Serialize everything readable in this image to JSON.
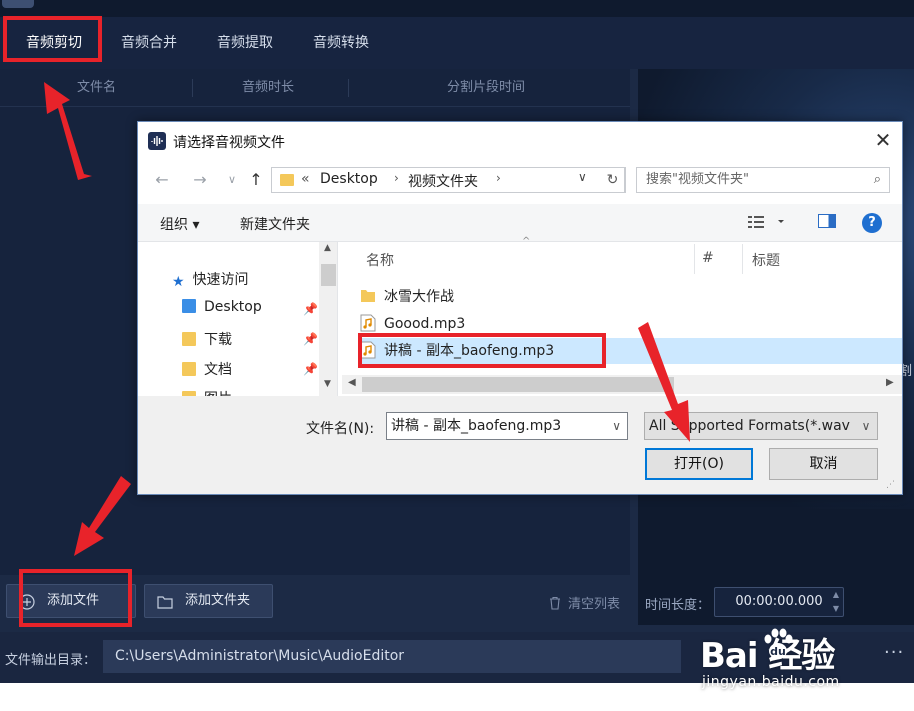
{
  "tabs": [
    "音频剪切",
    "音频合并",
    "音频提取",
    "音频转换"
  ],
  "columns": [
    "文件名",
    "音频时长",
    "分割片段时间"
  ],
  "bottom": {
    "add_file": "添加文件",
    "add_folder": "添加文件夹",
    "clear_list": "清空列表"
  },
  "duration": {
    "label": "时间长度：",
    "value": "00:00:00.000"
  },
  "output": {
    "label": "文件输出目录：",
    "path": "C:\\Users\\Administrator\\Music\\AudioEditor",
    "more": "···"
  },
  "right_edge_char": "割",
  "dialog": {
    "title": "请选择音视频文件",
    "address": {
      "prefix": "«",
      "seg1": "Desktop",
      "seg2": "视频文件夹"
    },
    "search_placeholder": "搜索\"视频文件夹\"",
    "organize": "组织 ▾",
    "new_folder": "新建文件夹",
    "nav": {
      "quick_access": "快速访问",
      "items": [
        "Desktop",
        "下载",
        "文档",
        "图片"
      ]
    },
    "file_headers": {
      "name": "名称",
      "num": "#",
      "title": "标题"
    },
    "files": [
      "冰雪大作战",
      "Goood.mp3",
      "讲稿 - 副本_baofeng.mp3"
    ],
    "filename_label": "文件名(N):",
    "filename_value": "讲稿 - 副本_baofeng.mp3",
    "filetype": "All Supported Formats(*.wav",
    "open": "打开(O)",
    "cancel": "取消"
  },
  "watermark": {
    "brand": "Bai  经验",
    "url": "jingyan.baidu.com"
  },
  "colors": {
    "app_bg": "#1c2a45",
    "annotation_red": "#e8232a",
    "dialog_accent": "#0078d7"
  }
}
